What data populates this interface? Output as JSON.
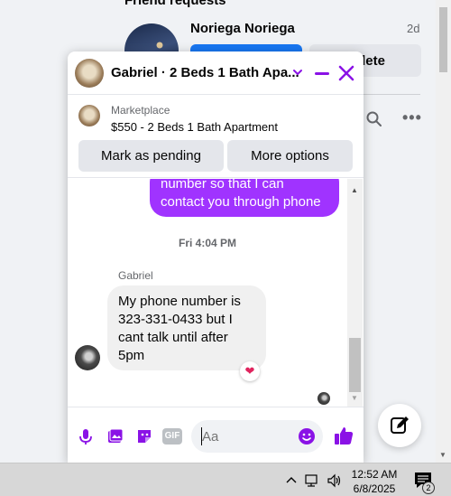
{
  "background": {
    "section_header": "Friend requests",
    "friend_name": "Noriega Noriega",
    "friend_time": "2d",
    "delete_button_label": "Delete",
    "delete_button_visible_text": "lete"
  },
  "chat": {
    "title": "Gabriel · 2 Beds 1 Bath Apa...",
    "accent_color": "#8a12e6",
    "marketplace": {
      "label": "Marketplace",
      "listing": "$550 - 2 Beds 1 Bath Apartment",
      "pending_button": "Mark as pending",
      "options_button": "More options"
    },
    "messages": {
      "outgoing_partial": "number so that I can contact you through phone",
      "outgoing_color": "#a033ff",
      "timestamp": "Fri 4:04 PM",
      "sender": "Gabriel",
      "incoming_text": "My phone number is 323-331-0433 but I cant talk until after 5pm",
      "reaction": "❤"
    },
    "composer": {
      "placeholder": "Aa",
      "icons": [
        "microphone-icon",
        "photo-icon",
        "sticker-icon",
        "gif-icon",
        "emoji-icon",
        "like-icon"
      ],
      "gif_label": "GIF"
    }
  },
  "taskbar": {
    "time": "12:52 AM",
    "date": "6/8/2025",
    "notification_count": "2"
  }
}
